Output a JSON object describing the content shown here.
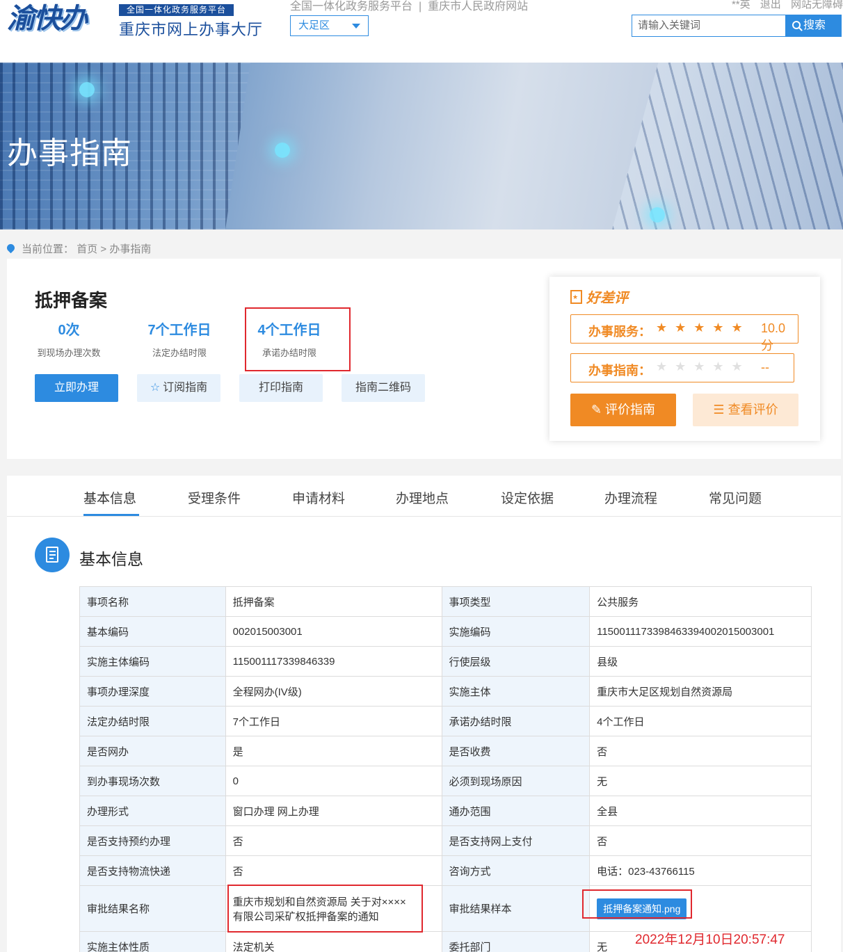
{
  "header": {
    "logo_text": "渝快办",
    "platform_badge": "全国一体化政务服务平台",
    "site_title": "重庆市网上办事大厅",
    "top_links": [
      "全国一体化政务服务平台",
      "重庆市人民政府网站"
    ],
    "top_sep": "|",
    "region": "大足区",
    "user_links": [
      "**英",
      "退出",
      "网站无障碍"
    ],
    "search_placeholder": "请输入关键词",
    "search_button": "搜索"
  },
  "banner": {
    "title": "办事指南"
  },
  "breadcrumb": {
    "prefix": "当前位置：",
    "home": "首页",
    "sep": ">",
    "current": "办事指南"
  },
  "summary": {
    "title": "抵押备案",
    "stats": [
      {
        "value": "0次",
        "label": "到现场办理次数"
      },
      {
        "value": "7个工作日",
        "label": "法定办结时限"
      },
      {
        "value": "4个工作日",
        "label": "承诺办结时限"
      }
    ],
    "buttons": {
      "apply": "立即办理",
      "subscribe": "订阅指南",
      "print": "打印指南",
      "qrcode": "指南二维码"
    }
  },
  "rating": {
    "title": "好差评",
    "rows": [
      {
        "label": "办事服务：",
        "stars": "★★★★★",
        "value": "10.0分"
      },
      {
        "label": "办事指南：",
        "stars": "★★★★★",
        "value": "--"
      }
    ],
    "evaluate_button": "评价指南",
    "view_button": "查看评价",
    "colors": {
      "accent": "#f08a24",
      "primary": "#2d8be0"
    }
  },
  "tabs": [
    "基本信息",
    "受理条件",
    "申请材料",
    "办理地点",
    "设定依据",
    "办理流程",
    "常见问题"
  ],
  "section": {
    "title": "基本信息"
  },
  "table": [
    [
      "事项名称",
      "抵押备案",
      "事项类型",
      "公共服务"
    ],
    [
      "基本编码",
      "002015003001",
      "实施编码",
      "11500111733984633940020150030​01"
    ],
    [
      "实施主体编码",
      "115001117339846339",
      "行使层级",
      "县级"
    ],
    [
      "事项办理深度",
      "全程网办(IV级)",
      "实施主体",
      "重庆市大足区规划自然资源局"
    ],
    [
      "法定办结时限",
      "7个工作日",
      "承诺办结时限",
      "4个工作日"
    ],
    [
      "是否网办",
      "是",
      "是否收费",
      "否"
    ],
    [
      "到办事现场次数",
      "0",
      "必须到现场原因",
      "无"
    ],
    [
      "办理形式",
      "窗口办理 网上办理",
      "通办范围",
      "全县"
    ],
    [
      "是否支持预约办理",
      "否",
      "是否支持网上支付",
      "否"
    ],
    [
      "是否支持物流快递",
      "否",
      "咨询方式",
      "电话：023-43766115"
    ]
  ],
  "result_row": {
    "k1": "审批结果名称",
    "v1_line1": "重庆市规划和自然资源局 关于对××××",
    "v1_line2": "有限公司采矿权抵押备案的通知",
    "k2": "审批结果样本",
    "file": "抵押备案通知.png"
  },
  "last_row": [
    "实施主体性质",
    "法定机关",
    "委托部门",
    "无"
  ],
  "timestamp": "2022年12月10日20:57:47"
}
